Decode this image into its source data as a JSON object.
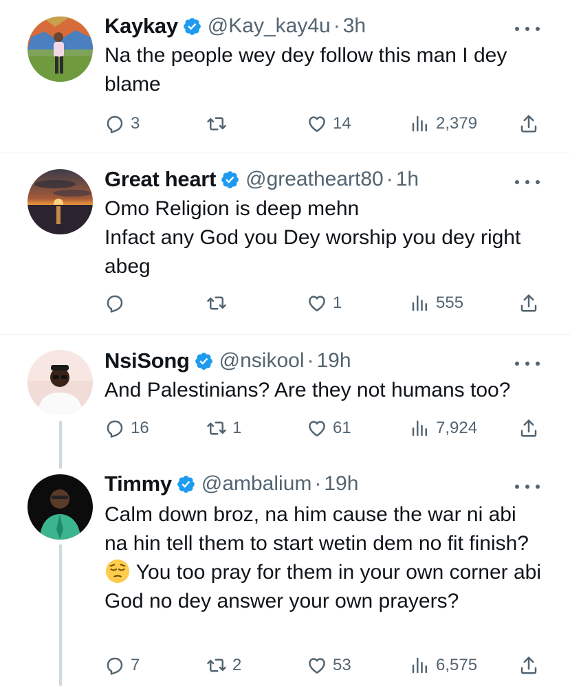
{
  "tweets": [
    {
      "name": "Kaykay",
      "handle": "@Kay_kay4u",
      "dot": "·",
      "time": "3h",
      "text": "Na the people wey dey follow this man I dey blame",
      "replies": "3",
      "retweets": "",
      "likes": "14",
      "views": "2,379"
    },
    {
      "name": "Great heart",
      "handle": "@greatheart80",
      "dot": "·",
      "time": "1h",
      "text": "Omo Religion is deep mehn\nInfact any God you Dey worship you dey right abeg",
      "replies": "",
      "retweets": "",
      "likes": "1",
      "views": "555"
    },
    {
      "name": "NsiSong",
      "handle": "@nsikool",
      "dot": "·",
      "time": "19h",
      "text": "And Palestinians? Are they not humans too?",
      "replies": "16",
      "retweets": "1",
      "likes": "61",
      "views": "7,924"
    },
    {
      "name": "Timmy",
      "handle": "@ambalium",
      "dot": "·",
      "time": "19h",
      "text_before_emoji": "Calm down broz, na him cause the war ni abi na hin tell them to start wetin dem no fit finish?",
      "text_after_emoji": " You too pray for them in your own corner abi God no dey answer your own prayers?",
      "emoji": "pensive-face",
      "replies": "7",
      "retweets": "2",
      "likes": "53",
      "views": "6,575"
    }
  ],
  "colors": {
    "verified": "#1d9bf0",
    "muted": "#536471",
    "text": "#0f1419",
    "divider": "#eff3f4",
    "thread_line": "#cfd9de"
  },
  "icons": [
    "reply-icon",
    "retweet-icon",
    "like-icon",
    "views-icon",
    "share-icon",
    "verified-badge-icon",
    "more-options-icon"
  ]
}
